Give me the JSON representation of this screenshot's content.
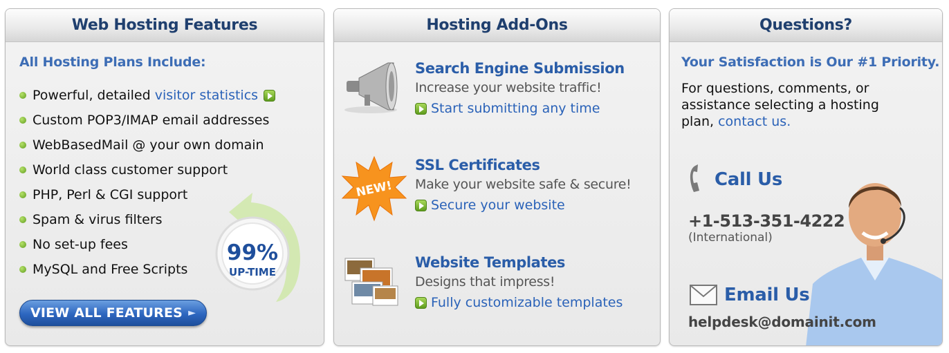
{
  "features_panel": {
    "title": "Web Hosting Features",
    "subtitle": "All Hosting Plans Include:",
    "items": [
      {
        "label": "Powerful, detailed ",
        "link": "visitor statistics"
      },
      {
        "label": "Custom POP3/IMAP email addresses"
      },
      {
        "label": "WebBasedMail @ your own domain"
      },
      {
        "label": "World class customer support"
      },
      {
        "label": "PHP, Perl & CGI support"
      },
      {
        "label": "Spam & virus filters"
      },
      {
        "label": "No set-up fees"
      },
      {
        "label": "MySQL and Free Scripts"
      }
    ],
    "uptime_badge": {
      "percent": "99%",
      "label": "UP-TIME"
    },
    "view_all_button": "VIEW ALL FEATURES"
  },
  "addons_panel": {
    "title": "Hosting Add-Ons",
    "items": [
      {
        "icon": "megaphone-icon",
        "title": "Search Engine Submission",
        "desc": "Increase your website traffic!",
        "cta": "Start submitting any time"
      },
      {
        "icon": "new-starburst-icon",
        "badge": "NEW!",
        "title": "SSL Certificates",
        "desc": "Make your website safe & secure!",
        "cta": "Secure your website"
      },
      {
        "icon": "templates-icon",
        "title": "Website Templates",
        "desc": "Designs that impress!",
        "cta": "Fully customizable templates"
      }
    ]
  },
  "questions_panel": {
    "title": "Questions?",
    "subtitle": "Your Satisfaction is Our #1 Priority.",
    "text": "For questions, comments, or assistance selecting a hosting plan, ",
    "contact_link": "contact us.",
    "call": {
      "label": "Call Us",
      "phone": "+1-513-351-4222",
      "note": "(International)"
    },
    "email": {
      "label": "Email Us",
      "address": "helpdesk@domainit.com"
    }
  },
  "colors": {
    "heading": "#1f3f6e",
    "link": "#2a62b8",
    "accent_green": "#5f9c1e",
    "button_blue": "#2d66bf"
  }
}
